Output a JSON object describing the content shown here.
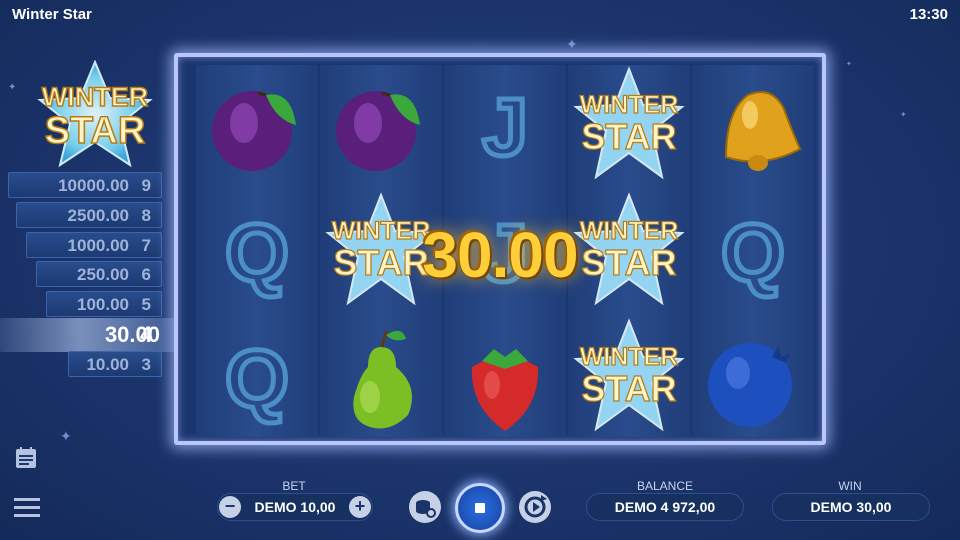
{
  "header": {
    "title": "Winter Star",
    "time": "13:30"
  },
  "paytable": {
    "logo_line1": "WINTER",
    "logo_line2": "STAR",
    "rows": [
      {
        "amount": "10000.00",
        "count": "9",
        "active": false
      },
      {
        "amount": "2500.00",
        "count": "8",
        "active": false
      },
      {
        "amount": "1000.00",
        "count": "7",
        "active": false
      },
      {
        "amount": "250.00",
        "count": "6",
        "active": false
      },
      {
        "amount": "100.00",
        "count": "5",
        "active": false
      },
      {
        "amount": "30.00",
        "count": "4",
        "active": true
      },
      {
        "amount": "10.00",
        "count": "3",
        "active": false
      }
    ]
  },
  "reels": {
    "symbol_texts": {
      "winter": "WINTER",
      "star": "STAR",
      "j": "J",
      "q": "Q"
    },
    "grid": [
      [
        "plum",
        "q",
        "q"
      ],
      [
        "plum",
        "winter-star",
        "pear"
      ],
      [
        "j",
        "j",
        "strawberry"
      ],
      [
        "winter-star",
        "winter-star",
        "winter-star"
      ],
      [
        "bell",
        "q",
        "blueberry"
      ]
    ],
    "win_amount": "30.00"
  },
  "controls": {
    "bet_label": "BET",
    "bet_value": "DEMO 10,00",
    "balance_label": "BALANCE",
    "balance_value": "DEMO 4 972,00",
    "win_label": "WIN",
    "win_value": "DEMO 30,00",
    "minus": "−",
    "plus": "+"
  },
  "colors": {
    "accent_gold": "#ffcf3a",
    "frame_glow": "#b9c7ff",
    "background": "#1d3770"
  }
}
